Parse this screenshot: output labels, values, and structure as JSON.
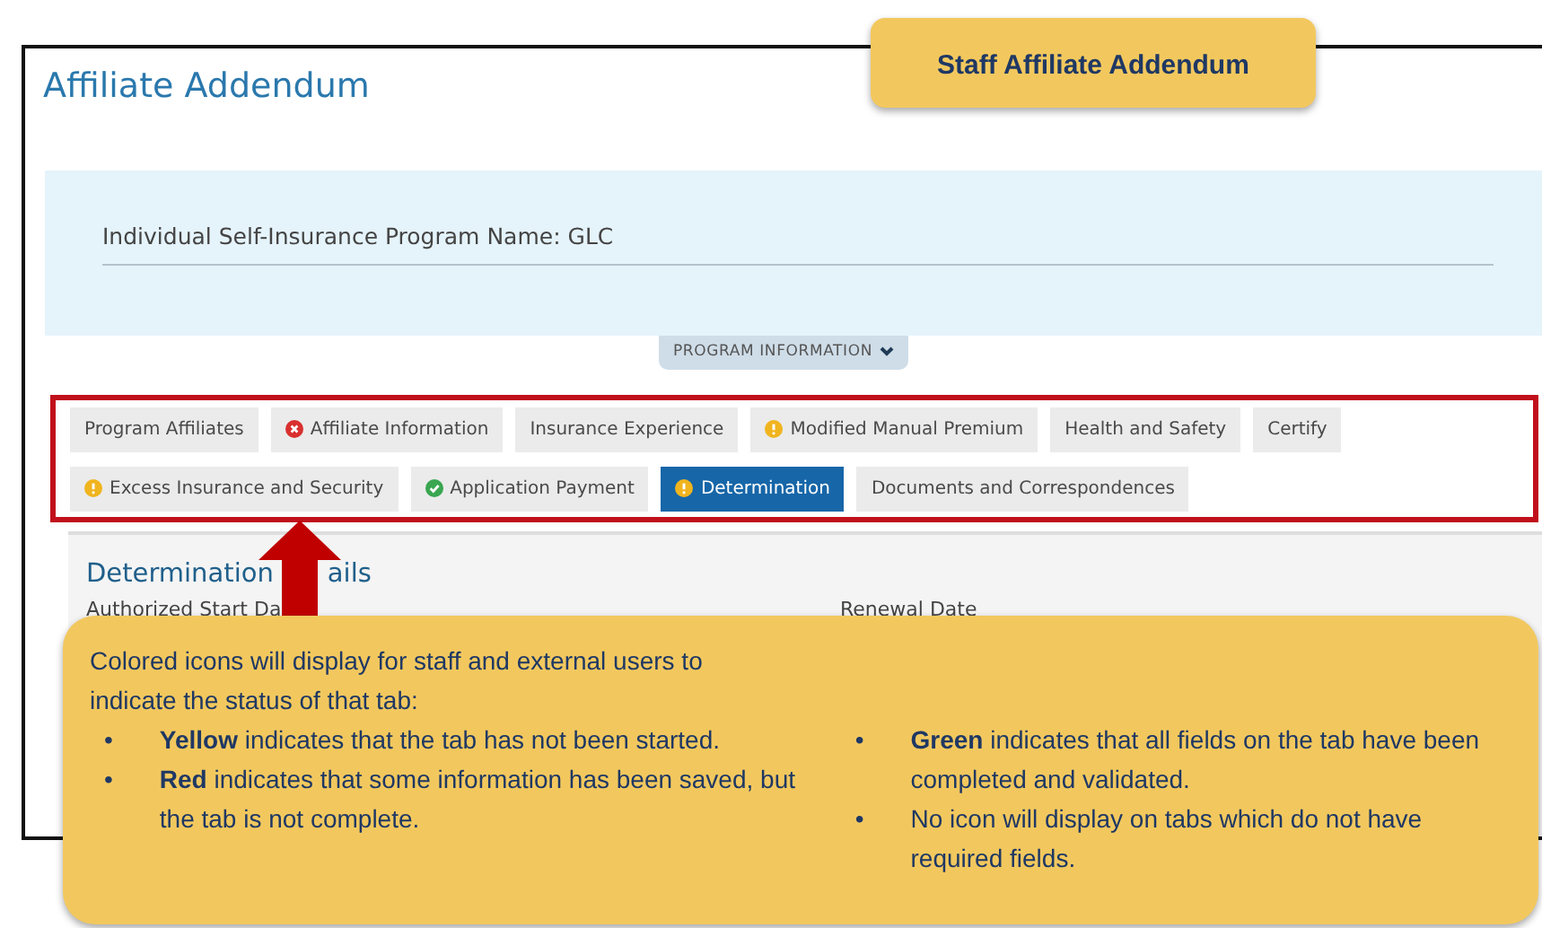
{
  "page": {
    "title": "Affiliate Addendum",
    "field": {
      "label": "Individual Self-Insurance Program Name:",
      "value": "GLC"
    },
    "section_toggle": {
      "label": "PROGRAM INFORMATION",
      "expanded": false
    }
  },
  "tabs": [
    {
      "label": "Program Affiliates",
      "selected": false
    },
    {
      "label": "Affiliate Information",
      "kind": "error",
      "selected": false
    },
    {
      "label": "Insurance Experience",
      "selected": false
    },
    {
      "label": "Modified Manual Premium",
      "kind": "warning",
      "selected": false
    },
    {
      "label": "Health and Safety",
      "selected": false
    },
    {
      "label": "Certify",
      "selected": false
    },
    {
      "label": "Excess Insurance and Security",
      "kind": "warning",
      "selected": false
    },
    {
      "label": "Application Payment",
      "kind": "complete",
      "selected": false
    },
    {
      "label": "Determination",
      "kind": "warning",
      "selected": true
    },
    {
      "label": "Documents and Correspondences",
      "selected": false
    }
  ],
  "content": {
    "heading": [
      "Determination",
      "ails"
    ],
    "fields": [
      "Authorized Start Da",
      "Renewal Date"
    ]
  },
  "callouts": {
    "title": "Staff Affiliate Addendum",
    "intro": "Colored icons will display for staff and external users to indicate the status of that tab:",
    "left": [
      {
        "bullet": "•",
        "text": "**Yellow** indicates that the tab has not been started."
      },
      {
        "bullet": "•",
        "text": "**Red** indicates that some information has been saved, but the tab is not complete."
      }
    ],
    "right": [
      {
        "bullet": "•",
        "text": "**Green** indicates that all fields on the tab have been completed and validated."
      },
      {
        "bullet": "•",
        "text": "No icon will display on tabs which do not have required fields."
      }
    ]
  }
}
